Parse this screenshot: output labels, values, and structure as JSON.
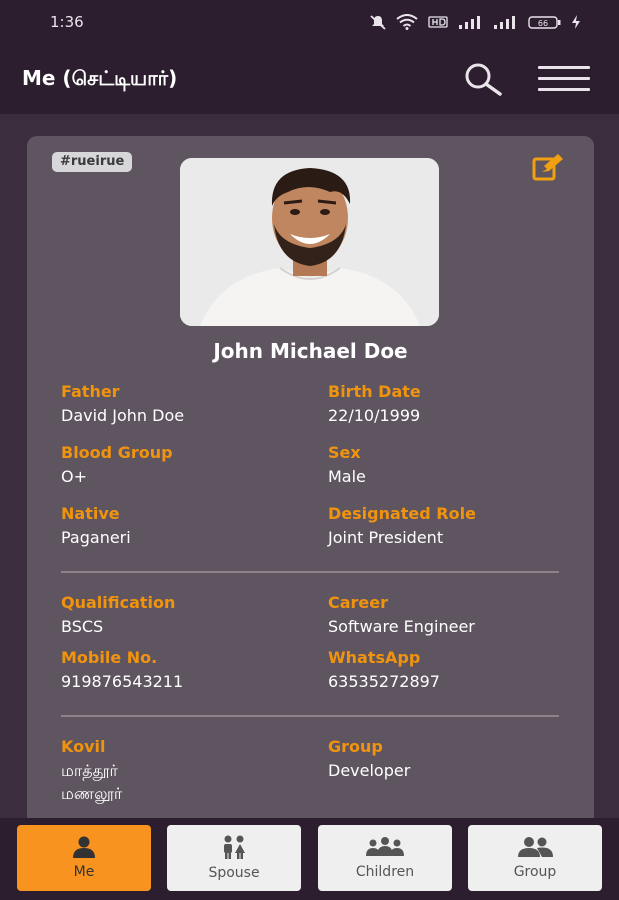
{
  "status_bar": {
    "time": "1:36",
    "battery": "66"
  },
  "app_bar": {
    "title": "Me (செட்டியார்)",
    "icons": [
      "search-icon",
      "menu-icon"
    ]
  },
  "profile": {
    "tag": "#rueirue",
    "name": "John Michael Doe",
    "fields": [
      {
        "label": "Father",
        "value": "David John Doe"
      },
      {
        "label": "Birth Date",
        "value": "22/10/1999"
      },
      {
        "label": "Blood Group",
        "value": "O+"
      },
      {
        "label": "Sex",
        "value": "Male"
      },
      {
        "label": "Native",
        "value": "Paganeri"
      },
      {
        "label": "Designated Role",
        "value": "Joint President"
      },
      {
        "label": "Qualification",
        "value": "BSCS"
      },
      {
        "label": "Career",
        "value": "Software Engineer"
      },
      {
        "label": "Mobile No.",
        "value": "919876543211"
      },
      {
        "label": "WhatsApp",
        "value": "63535272897"
      },
      {
        "label": "Kovil",
        "value": "மாத்தூர்",
        "value2": "மணலூர்"
      },
      {
        "label": "Group",
        "value": "Developer"
      }
    ]
  },
  "bottom_nav": {
    "items": [
      {
        "label": "Me",
        "icon": "person-icon",
        "active": true
      },
      {
        "label": "Spouse",
        "icon": "couple-icon",
        "active": false
      },
      {
        "label": "Children",
        "icon": "children-icon",
        "active": false
      },
      {
        "label": "Group",
        "icon": "group-icon",
        "active": false
      }
    ]
  },
  "colors": {
    "background": "#2c1e2e",
    "card": "#5f5560",
    "accent": "#f7931e",
    "label": "#f0930e"
  }
}
